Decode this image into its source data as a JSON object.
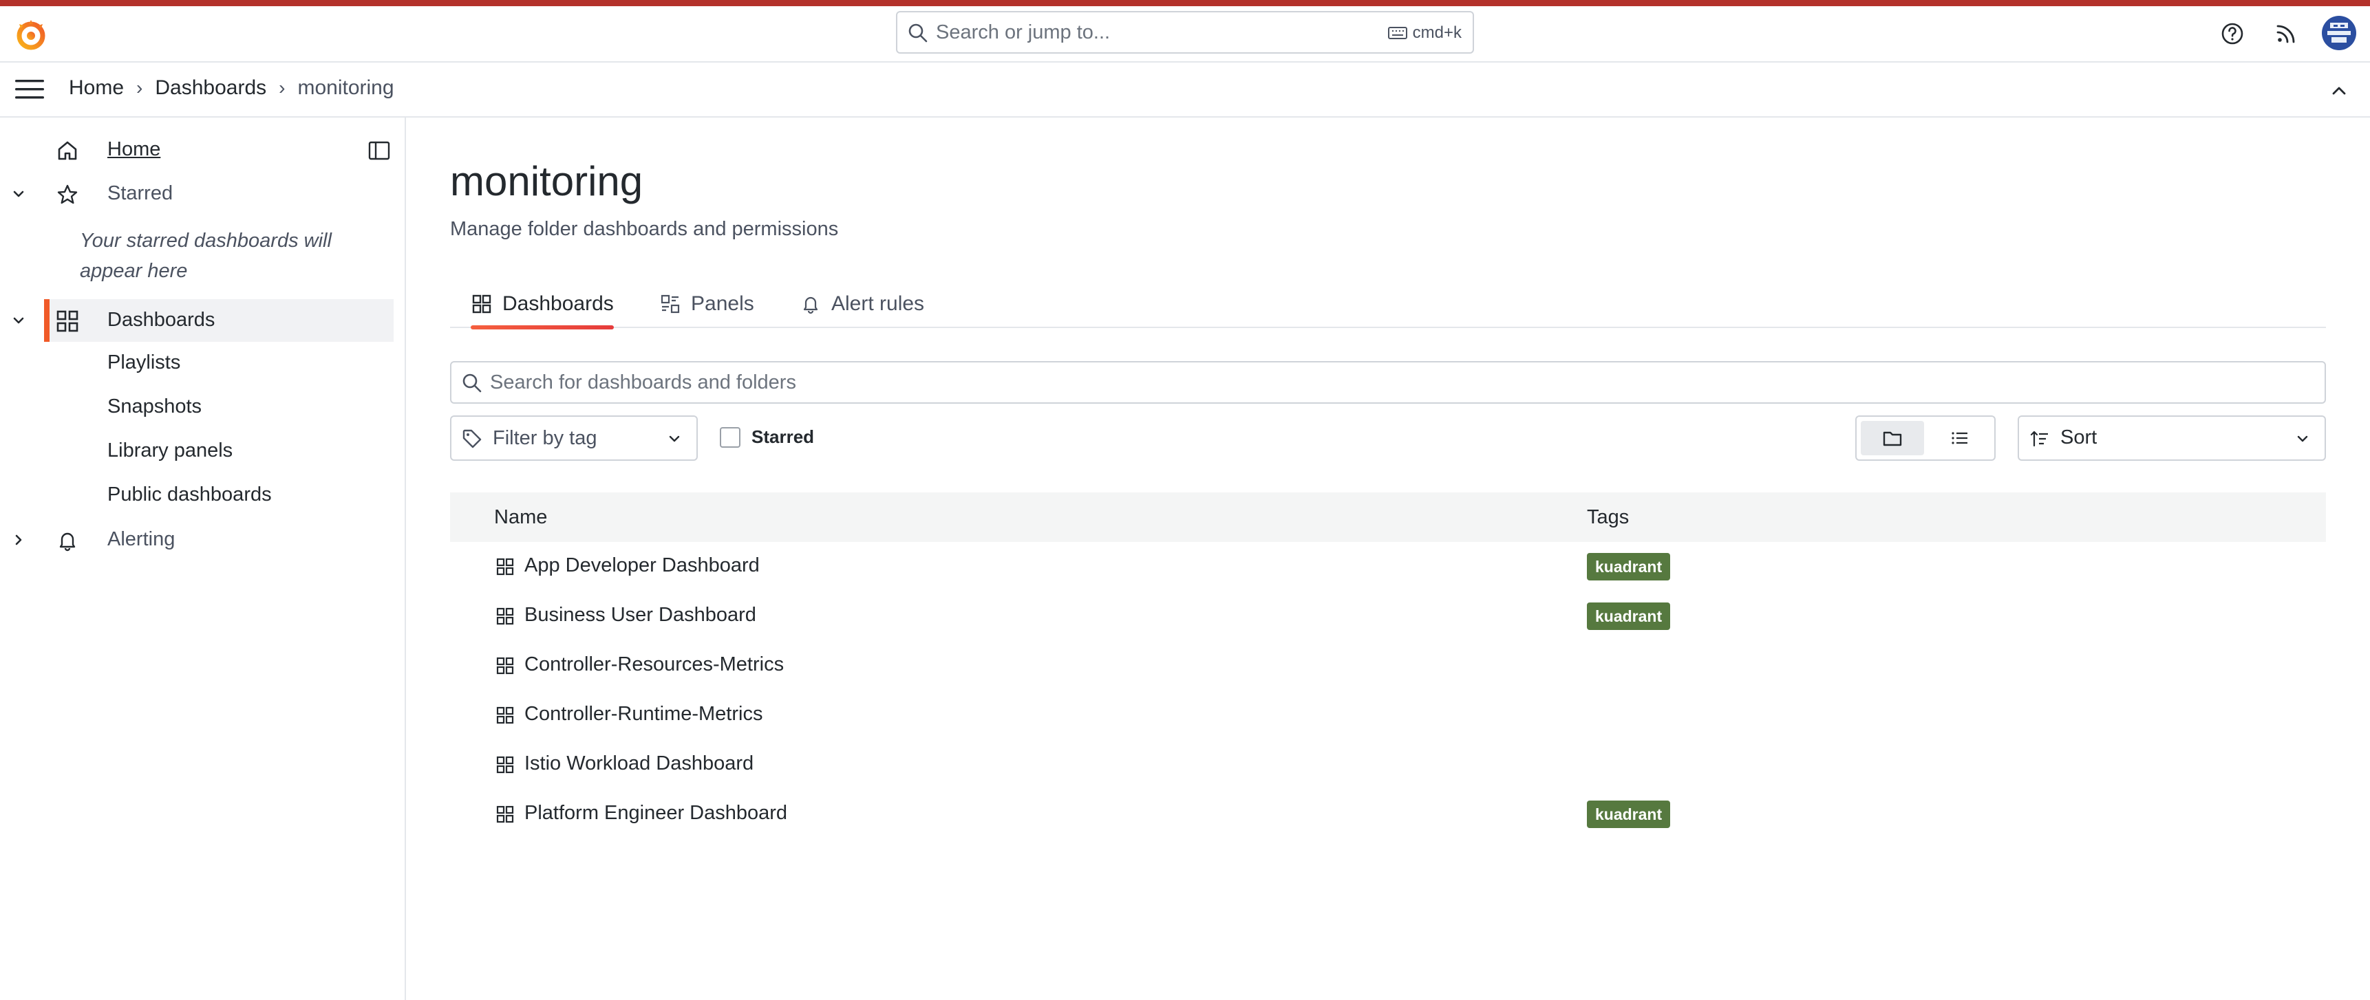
{
  "topbar": {
    "search_placeholder": "Search or jump to...",
    "search_shortcut": "cmd+k",
    "icons": [
      "grafana-logo-icon",
      "help-icon",
      "news-feed-icon",
      "user-avatar"
    ]
  },
  "breadcrumb": {
    "items": [
      "Home",
      "Dashboards",
      "monitoring"
    ]
  },
  "sidebar": {
    "home": "Home",
    "starred": "Starred",
    "starred_empty": "Your starred dashboards will appear here",
    "dashboards": "Dashboards",
    "sub_items": [
      "Playlists",
      "Snapshots",
      "Library panels",
      "Public dashboards"
    ],
    "alerting": "Alerting"
  },
  "page": {
    "title": "monitoring",
    "subtitle": "Manage folder dashboards and permissions",
    "tabs": [
      "Dashboards",
      "Panels",
      "Alert rules"
    ],
    "active_tab": "Dashboards"
  },
  "toolbar": {
    "search_placeholder": "Search for dashboards and folders",
    "filter_by_tag": "Filter by tag",
    "starred_label": "Starred",
    "starred_checked": false,
    "view_mode": "folder",
    "sort_label": "Sort"
  },
  "table": {
    "columns": [
      "Name",
      "Tags"
    ],
    "rows": [
      {
        "name": "App Developer Dashboard",
        "tags": [
          "kuadrant"
        ]
      },
      {
        "name": "Business User Dashboard",
        "tags": [
          "kuadrant"
        ]
      },
      {
        "name": "Controller-Resources-Metrics",
        "tags": []
      },
      {
        "name": "Controller-Runtime-Metrics",
        "tags": []
      },
      {
        "name": "Istio Workload Dashboard",
        "tags": []
      },
      {
        "name": "Platform Engineer Dashboard",
        "tags": [
          "kuadrant"
        ]
      }
    ]
  },
  "colors": {
    "accent": "#f05a28",
    "top_stripe": "#b4322b",
    "tag_bg": "#56793f",
    "avatar_bg": "#2b4ea0"
  }
}
